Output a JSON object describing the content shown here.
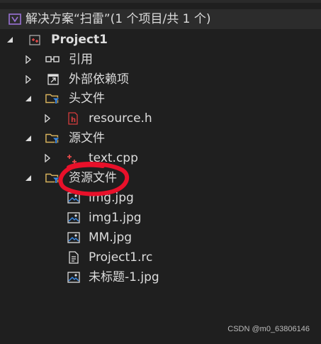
{
  "window": {
    "title": "解决方案“扫雷”(1 个项目/共 1 个)"
  },
  "tree": {
    "project": "Project1",
    "references": "引用",
    "external_deps": "外部依赖项",
    "header_files": "头文件",
    "header_items": [
      "resource.h"
    ],
    "source_files": "源文件",
    "source_items": [
      "text.cpp"
    ],
    "resource_files": "资源文件",
    "resource_items": [
      "img.jpg",
      "img1.jpg",
      "MM.jpg",
      "Project1.rc",
      "未标题-1.jpg"
    ]
  },
  "watermark": "CSDN @m0_63806146",
  "colors": {
    "background": "#1f1f1f",
    "text": "#dcdcdc",
    "folder": "#d8b25c",
    "filter_funnel": "#3c8ce8",
    "vs_purple": "#9a73d6",
    "header_red": "#d43c3c",
    "annotation_red": "#e8102a"
  },
  "icons": {
    "solution": "visual-studio-solution-icon",
    "project": "cpp-project-icon",
    "references": "references-icon",
    "external_deps": "external-dependencies-icon",
    "filter": "folder-filter-icon",
    "header_file": "header-file-icon",
    "cpp_file": "cpp-file-icon",
    "image_file": "image-file-icon",
    "resource_script": "resource-script-icon"
  }
}
